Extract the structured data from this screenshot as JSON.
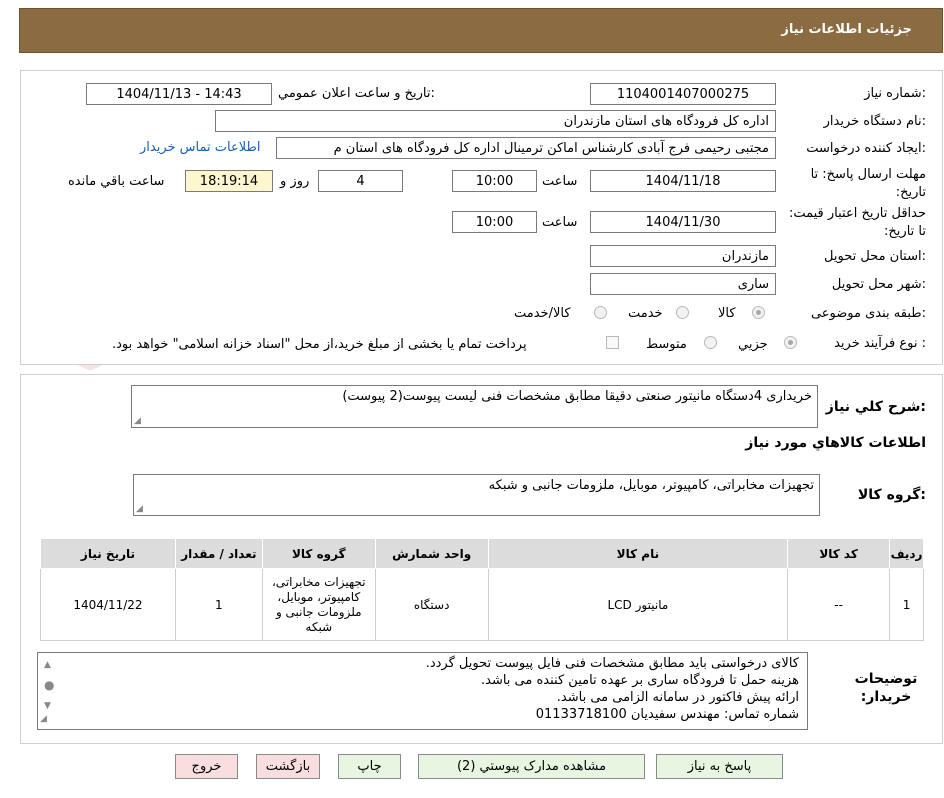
{
  "header": {
    "title": "جزئیات اطلاعات نیاز"
  },
  "form": {
    "need_number_label": "شماره نیاز:",
    "need_number": "1104001407000275",
    "announce_label": "تاریخ و ساعت اعلان عمومي:",
    "announce_value": "1404/11/13 - 14:43",
    "buyer_org_label": "نام دستگاه خریدار:",
    "buyer_org": "اداره کل فرودگاه های استان مازندران",
    "creator_label": "ایجاد کننده درخواست:",
    "creator": "مجتبی رحیمی فرج آبادی کارشناس اماکن ترمینال اداره کل فرودگاه های استان م",
    "contact_link": "اطلاعات تماس خريدار",
    "deadline_label": "مهلت ارسال پاسخ: تا تاریخ:",
    "deadline_date": "1404/11/18",
    "time_label": "ساعت",
    "deadline_time": "10:00",
    "days_value": "4",
    "days_label": "روز و",
    "remaining_time": "18:19:14",
    "remaining_label": "ساعت باقي مانده",
    "validity_label": "حداقل تاریخ اعتبار قیمت: تا تاریخ:",
    "validity_date": "1404/11/30",
    "validity_time": "10:00",
    "province_label": "استان محل تحویل:",
    "province": "مازندران",
    "city_label": "شهر محل تحویل:",
    "city": "ساری",
    "category_label": "طبقه بندی موضوعی:",
    "category_options": [
      "کالا",
      "خدمت",
      "کالا/خدمت"
    ],
    "category_selected": "کالا",
    "process_label": "نوع فرآیند خرید :",
    "process_options": [
      "جزیي",
      "متوسط"
    ],
    "process_selected": "جزیي",
    "payment_note": "پرداخت تمام یا بخشی از مبلغ خرید،از محل \"اسناد خزانه اسلامی\" خواهد بود."
  },
  "watermark": {
    "text": "AriaTender.neT"
  },
  "summary": {
    "desc_label": "شرح کلي نیاز:",
    "desc_text": "خریداری 4دستگاه مانیتور صنعتی دقیقا مطابق مشخصات فنی لیست پیوست(2 پیوست)",
    "items_heading": "اطلاعات کالاهاي مورد نیاز",
    "group_label": "گروه کالا:",
    "group_text": "تجهیزات مخابراتی، کامپیوتر، موبایل، ملزومات جانبی و شبکه"
  },
  "table": {
    "headers": [
      "ردیف",
      "کد کالا",
      "نام کالا",
      "واحد شمارش",
      "گروه کالا",
      "تعداد / مقدار",
      "تاریخ نیاز"
    ],
    "rows": [
      [
        "1",
        "--",
        "مانیتور LCD",
        "دستگاه",
        "تجهیزات مخابراتی، کامپیوتر، موبایل، ملزومات جانبی و شبکه",
        "1",
        "1404/11/22"
      ]
    ]
  },
  "notes": {
    "label": "توضیحات خریدار:",
    "lines": [
      "کالای درخواستی باید مطابق مشخصات فنی فایل پیوست تحویل گردد.",
      "هزینه حمل تا فرودگاه ساری بر عهده تامین کننده می باشد.",
      "ارائه پیش فاکتور در سامانه الزامی می باشد.",
      "شماره تماس: مهندس سفیدیان    01133718100"
    ]
  },
  "buttons": {
    "reply": "پاسخ به نیاز",
    "attachments": "مشاهده مدارک پیوستي (2)",
    "print": "چاپ",
    "back": "بازگشت",
    "exit": "خروج"
  },
  "colors": {
    "header": "#8b6b41",
    "green_button": "#e8f5e0",
    "red_button": "#f8dede",
    "remaining": "#fdf6cf"
  }
}
